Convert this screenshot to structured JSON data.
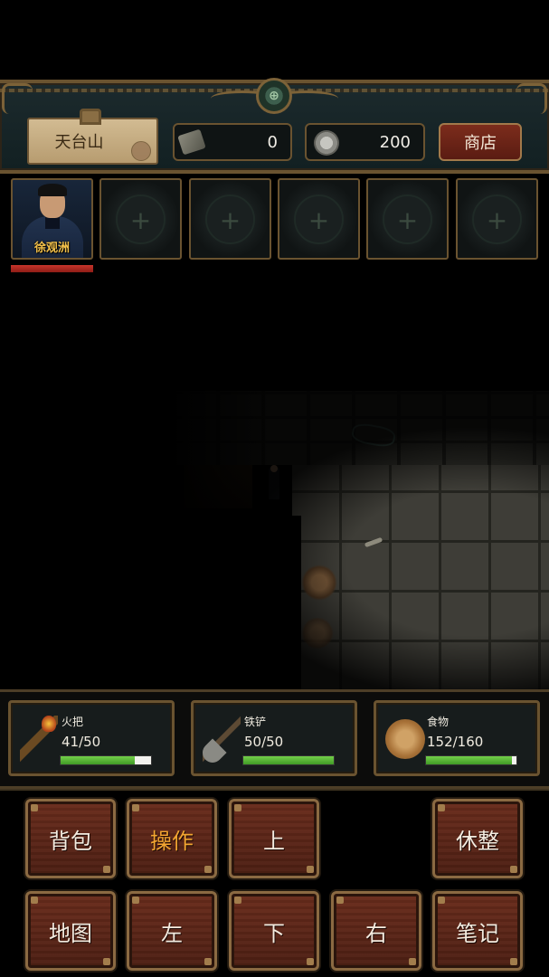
{
  "header": {
    "location": "天台山",
    "ticket_count": "0",
    "coin_count": "200",
    "shop_label": "商店",
    "medallion_glyph": "⊕",
    "icons": [
      "ticket-icon",
      "coin-icon"
    ]
  },
  "party": {
    "hero_name": "徐观洲",
    "hp_fraction": 1.0,
    "empty_slot_glyph": "+"
  },
  "tools": [
    {
      "label": "火把",
      "value": "41/50",
      "fraction": 0.82,
      "icon": "torch-icon"
    },
    {
      "label": "铁铲",
      "value": "50/50",
      "fraction": 1.0,
      "icon": "shovel-icon"
    },
    {
      "label": "食物",
      "value": "152/160",
      "fraction": 0.95,
      "icon": "food-icon"
    }
  ],
  "controls": {
    "backpack": "背包",
    "action": "操作",
    "up": "上",
    "rest": "休整",
    "map": "地图",
    "left": "左",
    "down": "下",
    "right": "右",
    "notes": "笔记"
  },
  "colors": {
    "frame_gold": "#6a5330",
    "button_red": "#5a1c12",
    "active_text": "#f2a531",
    "hp_red": "#c8352b",
    "bar_green": "#5cb83a"
  }
}
